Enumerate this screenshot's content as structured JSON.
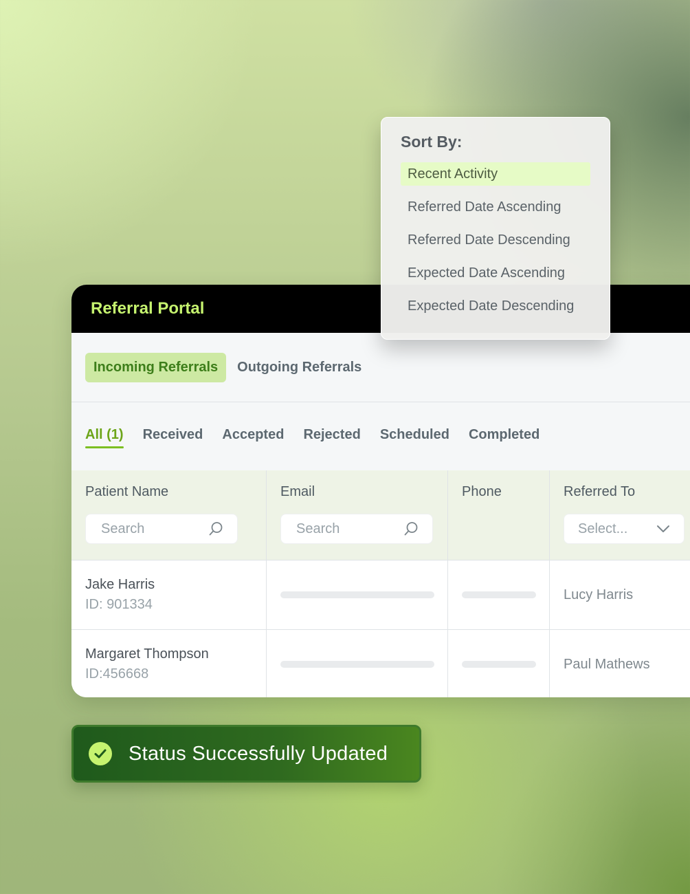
{
  "portal": {
    "title": "Referral Portal",
    "referral_tabs": [
      "Incoming Referrals",
      "Outgoing Referrals"
    ],
    "active_referral_tab": "Incoming Referrals",
    "status_tabs": [
      "All (1)",
      "Received",
      "Accepted",
      "Rejected",
      "Scheduled",
      "Completed"
    ],
    "active_status_tab": "All (1)"
  },
  "table": {
    "columns": {
      "patient_name": "Patient Name",
      "email": "Email",
      "phone": "Phone",
      "referred_to": "Referred To"
    },
    "filters": {
      "patient_name_placeholder": "Search",
      "email_placeholder": "Search",
      "referred_to_placeholder": "Select..."
    },
    "rows": [
      {
        "name": "Jake Harris",
        "id": "ID: 901334",
        "referred_to": "Lucy Harris"
      },
      {
        "name": "Margaret Thompson",
        "id": "ID:456668",
        "referred_to": "Paul Mathews"
      }
    ]
  },
  "sort_menu": {
    "title": "Sort By:",
    "options": [
      "Recent Activity",
      "Referred Date Ascending",
      "Referred Date Descending",
      "Expected Date Ascending",
      "Expected Date Descending"
    ],
    "selected": "Recent Activity"
  },
  "toast": {
    "message": "Status Successfully Updated",
    "icon": "check-circle-icon"
  },
  "colors": {
    "accent": "#c6f36f",
    "active_tab_bg": "#cde9a3",
    "active_tab_text": "#3d7e1a",
    "header_bg": "#000000",
    "toast_bg": "#2f6a1f",
    "sort_selected_bg": "#e6fbc6"
  }
}
